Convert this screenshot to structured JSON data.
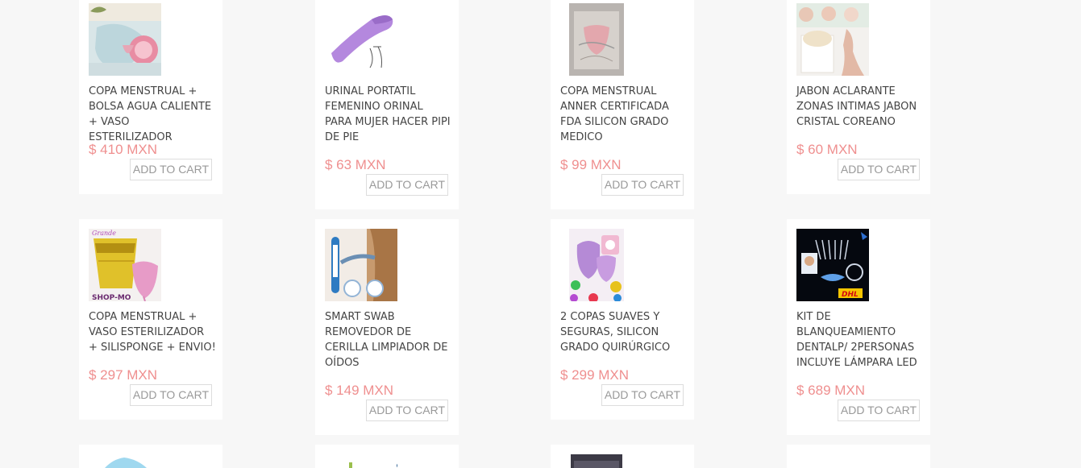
{
  "products": [
    {
      "title": "COPA MENSTRUAL + BOLSA AGUA CALIENTE + VASO ESTERILIZADOR",
      "price": "$ 410 MXN",
      "cart_label": "ADD TO CART"
    },
    {
      "title": "URINAL PORTATIL FEMENINO ORINAL PARA MUJER HACER PIPI DE PIE",
      "price": "$ 63 MXN",
      "cart_label": "ADD TO CART"
    },
    {
      "title": "COPA MENSTRUAL ANNER CERTIFICADA FDA SILICON GRADO MEDICO",
      "price": "$ 99 MXN",
      "cart_label": "ADD TO CART"
    },
    {
      "title": "JABON ACLARANTE ZONAS INTIMAS JABON CRISTAL COREANO",
      "price": "$ 60 MXN",
      "cart_label": "ADD TO CART"
    },
    {
      "title": "COPA MENSTRUAL + VASO ESTERILIZADOR + SILISPONGE + ENVIO!",
      "price": "$ 297 MXN",
      "cart_label": "ADD TO CART"
    },
    {
      "title": "SMART SWAB REMOVEDOR DE CERILLA LIMPIADOR DE OÍDOS",
      "price": "$ 149 MXN",
      "cart_label": "ADD TO CART"
    },
    {
      "title": "2 COPAS SUAVES Y SEGURAS, SILICON GRADO QUIRÚRGICO",
      "price": "$ 299 MXN",
      "cart_label": "ADD TO CART"
    },
    {
      "title": "KIT DE BLANQUEAMIENTO DENTALP/ 2PERSONAS INCLUYE LÁMPARA LED",
      "price": "$ 689 MXN",
      "cart_label": "ADD TO CART"
    }
  ],
  "image_text": {
    "p5_top": "Grande",
    "p5_bottom": "SHOP-MO",
    "p8_brand": "DHL"
  },
  "colors": {
    "page_bg": "#f7f7f7",
    "card_bg": "#ffffff",
    "price": "#ef8f8f",
    "title": "#444444",
    "button_text": "#999999",
    "button_border": "#dddddd"
  }
}
